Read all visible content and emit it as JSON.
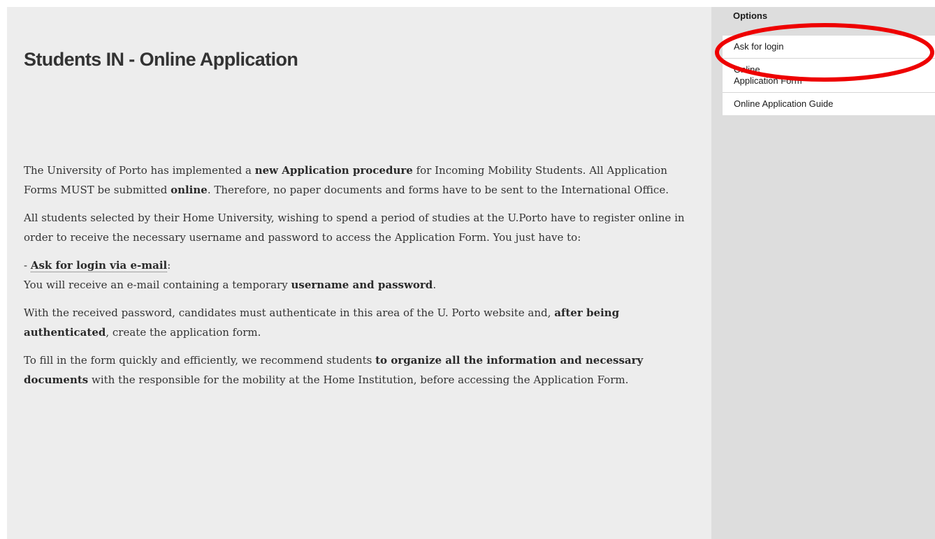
{
  "page": {
    "title": "Students IN - Online Application"
  },
  "content": {
    "p1": {
      "t1": "The University of Porto has implemented a ",
      "b1": "new Application procedure",
      "t2": " for Incoming Mobility Students. All Application Forms MUST be submitted ",
      "b2": "online",
      "t3": ". Therefore, no paper documents and forms have to be sent to the International Office."
    },
    "p2": {
      "text": "All students selected by their Home University, wishing to spend a period of studies at the U.Porto have to register online in order to receive the necessary username and password to access the Application Form. You just have to:"
    },
    "p3": {
      "prefix": "- ",
      "link": "Ask for login via e-mail",
      "colon": ":",
      "t1": "You will receive an e-mail containing a temporary ",
      "b1": "username and password",
      "t2": "."
    },
    "p4": {
      "t1": "With the received password, candidates must authenticate in this area of the U. Porto website and, ",
      "b1": "after being authenticated",
      "t2": ", create the application form."
    },
    "p5": {
      "t1": "To fill in the form quickly and efficiently, we recommend students ",
      "b1": "to organize all the information and necessary documents",
      "t2": " with the responsible for the mobility at the Home Institution, before accessing the Application Form."
    }
  },
  "sidebar": {
    "heading": "Options",
    "items": [
      {
        "label_line1": "Ask for login"
      },
      {
        "label_line1": "Online",
        "label_line2": "Application Form"
      },
      {
        "label_line1": "Online Application Guide"
      }
    ]
  },
  "annotation": {
    "color": "#ee0000"
  }
}
